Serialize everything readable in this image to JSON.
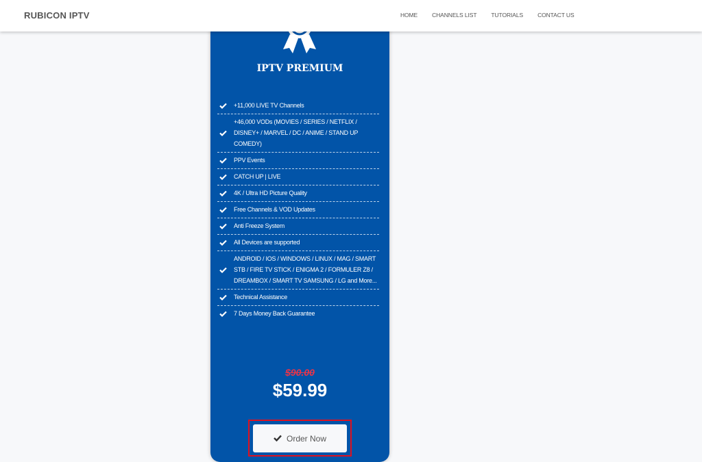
{
  "header": {
    "brand": "RUBICON IPTV",
    "nav": [
      {
        "label": "HOME"
      },
      {
        "label": "CHANNELS LIST"
      },
      {
        "label": "TUTORIALS"
      },
      {
        "label": "CONTACT US"
      }
    ]
  },
  "plan": {
    "icon": "award-ribbon-icon",
    "title": "IPTV PREMIUM",
    "features": [
      "+11,000 LIVE TV Channels",
      "+46,000 VODs (MOVIES / SERIES / NETFLIX / DISNEY+ / MARVEL / DC / ANIME / STAND UP COMEDY)",
      "PPV Events",
      "CATCH UP | LIVE",
      "4K / Ultra HD Picture Quality",
      "Free Channels & VOD Updates",
      "Anti Freeze System",
      "All Devices are supported",
      "ANDROID / IOS / WINDOWS / LINUX / MAG / SMART STB / FIRE TV STICK / ENIGMA 2 / FORMULER Z8 / DREAMBOX / SMART TV SAMSUNG / LG and More...",
      "Technical Assistance",
      "7 Days Money Back Guarantee"
    ],
    "old_price": "$90.00",
    "price": "$59.99",
    "order_label": "Order Now"
  },
  "colors": {
    "card_bg": "#0254a8",
    "old_price": "#e8344a",
    "highlight_border": "#e0111f",
    "page_bg": "#f7f8fa"
  }
}
